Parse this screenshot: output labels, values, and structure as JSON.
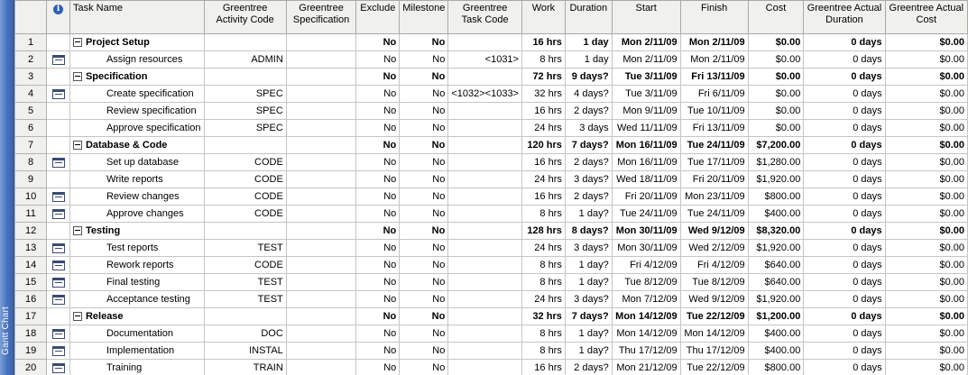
{
  "side_label": "Gantt Chart",
  "headers": {
    "indicators_icon": "info-icon",
    "task_name": "Task Name",
    "activity_code": "Greentree Activity Code",
    "specification": "Greentree Specification",
    "exclude": "Exclude",
    "milestone": "Milestone",
    "task_code": "Greentree Task Code",
    "work": "Work",
    "duration": "Duration",
    "start": "Start",
    "finish": "Finish",
    "cost": "Cost",
    "actual_duration": "Greentree Actual Duration",
    "actual_cost": "Greentree Actual Cost"
  },
  "rows": [
    {
      "id": "1",
      "summary": true,
      "icon": "",
      "name": "Project Setup",
      "activity": "",
      "spec": "",
      "exclude": "No",
      "milestone": "No",
      "taskcode": "",
      "work": "16 hrs",
      "duration": "1 day",
      "start": "Mon 2/11/09",
      "finish": "Mon 2/11/09",
      "cost": "$0.00",
      "actdur": "0 days",
      "actcost": "$0.00"
    },
    {
      "id": "2",
      "summary": false,
      "icon": "table-icon",
      "name": "Assign resources",
      "activity": "ADMIN",
      "spec": "",
      "exclude": "No",
      "milestone": "No",
      "taskcode": "<1031>",
      "work": "8 hrs",
      "duration": "1 day",
      "start": "Mon 2/11/09",
      "finish": "Mon 2/11/09",
      "cost": "$0.00",
      "actdur": "0 days",
      "actcost": "$0.00"
    },
    {
      "id": "3",
      "summary": true,
      "icon": "",
      "name": "Specification",
      "activity": "",
      "spec": "",
      "exclude": "No",
      "milestone": "No",
      "taskcode": "",
      "work": "72 hrs",
      "duration": "9 days?",
      "start": "Tue 3/11/09",
      "finish": "Fri 13/11/09",
      "cost": "$0.00",
      "actdur": "0 days",
      "actcost": "$0.00"
    },
    {
      "id": "4",
      "summary": false,
      "icon": "table-icon",
      "name": "Create specification",
      "activity": "SPEC",
      "spec": "",
      "exclude": "No",
      "milestone": "No",
      "taskcode": "<1032><1033>",
      "work": "32 hrs",
      "duration": "4 days?",
      "start": "Tue 3/11/09",
      "finish": "Fri 6/11/09",
      "cost": "$0.00",
      "actdur": "0 days",
      "actcost": "$0.00"
    },
    {
      "id": "5",
      "summary": false,
      "icon": "",
      "name": "Review specification",
      "activity": "SPEC",
      "spec": "",
      "exclude": "No",
      "milestone": "No",
      "taskcode": "",
      "work": "16 hrs",
      "duration": "2 days?",
      "start": "Mon 9/11/09",
      "finish": "Tue 10/11/09",
      "cost": "$0.00",
      "actdur": "0 days",
      "actcost": "$0.00"
    },
    {
      "id": "6",
      "summary": false,
      "icon": "",
      "name": "Approve specification",
      "activity": "SPEC",
      "spec": "",
      "exclude": "No",
      "milestone": "No",
      "taskcode": "",
      "work": "24 hrs",
      "duration": "3 days",
      "start": "Wed 11/11/09",
      "finish": "Fri 13/11/09",
      "cost": "$0.00",
      "actdur": "0 days",
      "actcost": "$0.00"
    },
    {
      "id": "7",
      "summary": true,
      "icon": "",
      "name": "Database & Code",
      "activity": "",
      "spec": "",
      "exclude": "No",
      "milestone": "No",
      "taskcode": "",
      "work": "120 hrs",
      "duration": "7 days?",
      "start": "Mon 16/11/09",
      "finish": "Tue 24/11/09",
      "cost": "$7,200.00",
      "actdur": "0 days",
      "actcost": "$0.00"
    },
    {
      "id": "8",
      "summary": false,
      "icon": "table-icon",
      "name": "Set up database",
      "activity": "CODE",
      "spec": "",
      "exclude": "No",
      "milestone": "No",
      "taskcode": "",
      "work": "16 hrs",
      "duration": "2 days?",
      "start": "Mon 16/11/09",
      "finish": "Tue 17/11/09",
      "cost": "$1,280.00",
      "actdur": "0 days",
      "actcost": "$0.00"
    },
    {
      "id": "9",
      "summary": false,
      "icon": "",
      "name": "Write reports",
      "activity": "CODE",
      "spec": "",
      "exclude": "No",
      "milestone": "No",
      "taskcode": "",
      "work": "24 hrs",
      "duration": "3 days?",
      "start": "Wed 18/11/09",
      "finish": "Fri 20/11/09",
      "cost": "$1,920.00",
      "actdur": "0 days",
      "actcost": "$0.00"
    },
    {
      "id": "10",
      "summary": false,
      "icon": "table-icon",
      "name": "Review changes",
      "activity": "CODE",
      "spec": "",
      "exclude": "No",
      "milestone": "No",
      "taskcode": "",
      "work": "16 hrs",
      "duration": "2 days?",
      "start": "Fri 20/11/09",
      "finish": "Mon 23/11/09",
      "cost": "$800.00",
      "actdur": "0 days",
      "actcost": "$0.00"
    },
    {
      "id": "11",
      "summary": false,
      "icon": "table-icon",
      "name": "Approve changes",
      "activity": "CODE",
      "spec": "",
      "exclude": "No",
      "milestone": "No",
      "taskcode": "",
      "work": "8 hrs",
      "duration": "1 day?",
      "start": "Tue 24/11/09",
      "finish": "Tue 24/11/09",
      "cost": "$400.00",
      "actdur": "0 days",
      "actcost": "$0.00"
    },
    {
      "id": "12",
      "summary": true,
      "icon": "",
      "name": "Testing",
      "activity": "",
      "spec": "",
      "exclude": "No",
      "milestone": "No",
      "taskcode": "",
      "work": "128 hrs",
      "duration": "8 days?",
      "start": "Mon 30/11/09",
      "finish": "Wed 9/12/09",
      "cost": "$8,320.00",
      "actdur": "0 days",
      "actcost": "$0.00"
    },
    {
      "id": "13",
      "summary": false,
      "icon": "table-icon",
      "name": "Test reports",
      "activity": "TEST",
      "spec": "",
      "exclude": "No",
      "milestone": "No",
      "taskcode": "",
      "work": "24 hrs",
      "duration": "3 days?",
      "start": "Mon 30/11/09",
      "finish": "Wed 2/12/09",
      "cost": "$1,920.00",
      "actdur": "0 days",
      "actcost": "$0.00"
    },
    {
      "id": "14",
      "summary": false,
      "icon": "table-icon",
      "name": "Rework reports",
      "activity": "CODE",
      "spec": "",
      "exclude": "No",
      "milestone": "No",
      "taskcode": "",
      "work": "8 hrs",
      "duration": "1 day?",
      "start": "Fri 4/12/09",
      "finish": "Fri 4/12/09",
      "cost": "$640.00",
      "actdur": "0 days",
      "actcost": "$0.00"
    },
    {
      "id": "15",
      "summary": false,
      "icon": "table-icon",
      "name": "Final testing",
      "activity": "TEST",
      "spec": "",
      "exclude": "No",
      "milestone": "No",
      "taskcode": "",
      "work": "8 hrs",
      "duration": "1 day?",
      "start": "Tue 8/12/09",
      "finish": "Tue 8/12/09",
      "cost": "$640.00",
      "actdur": "0 days",
      "actcost": "$0.00"
    },
    {
      "id": "16",
      "summary": false,
      "icon": "table-icon",
      "name": "Acceptance testing",
      "activity": "TEST",
      "spec": "",
      "exclude": "No",
      "milestone": "No",
      "taskcode": "",
      "work": "24 hrs",
      "duration": "3 days?",
      "start": "Mon 7/12/09",
      "finish": "Wed 9/12/09",
      "cost": "$1,920.00",
      "actdur": "0 days",
      "actcost": "$0.00"
    },
    {
      "id": "17",
      "summary": true,
      "icon": "",
      "name": "Release",
      "activity": "",
      "spec": "",
      "exclude": "No",
      "milestone": "No",
      "taskcode": "",
      "work": "32 hrs",
      "duration": "7 days?",
      "start": "Mon 14/12/09",
      "finish": "Tue 22/12/09",
      "cost": "$1,200.00",
      "actdur": "0 days",
      "actcost": "$0.00"
    },
    {
      "id": "18",
      "summary": false,
      "icon": "table-icon",
      "name": "Documentation",
      "activity": "DOC",
      "spec": "",
      "exclude": "No",
      "milestone": "No",
      "taskcode": "",
      "work": "8 hrs",
      "duration": "1 day?",
      "start": "Mon 14/12/09",
      "finish": "Mon 14/12/09",
      "cost": "$400.00",
      "actdur": "0 days",
      "actcost": "$0.00"
    },
    {
      "id": "19",
      "summary": false,
      "icon": "table-icon",
      "name": "Implementation",
      "activity": "INSTAL",
      "spec": "",
      "exclude": "No",
      "milestone": "No",
      "taskcode": "",
      "work": "8 hrs",
      "duration": "1 day?",
      "start": "Thu 17/12/09",
      "finish": "Thu 17/12/09",
      "cost": "$400.00",
      "actdur": "0 days",
      "actcost": "$0.00"
    },
    {
      "id": "20",
      "summary": false,
      "icon": "table-icon",
      "name": "Training",
      "activity": "TRAIN",
      "spec": "",
      "exclude": "No",
      "milestone": "No",
      "taskcode": "",
      "work": "16 hrs",
      "duration": "2 days?",
      "start": "Mon 21/12/09",
      "finish": "Tue 22/12/09",
      "cost": "$800.00",
      "actdur": "0 days",
      "actcost": "$0.00"
    }
  ]
}
